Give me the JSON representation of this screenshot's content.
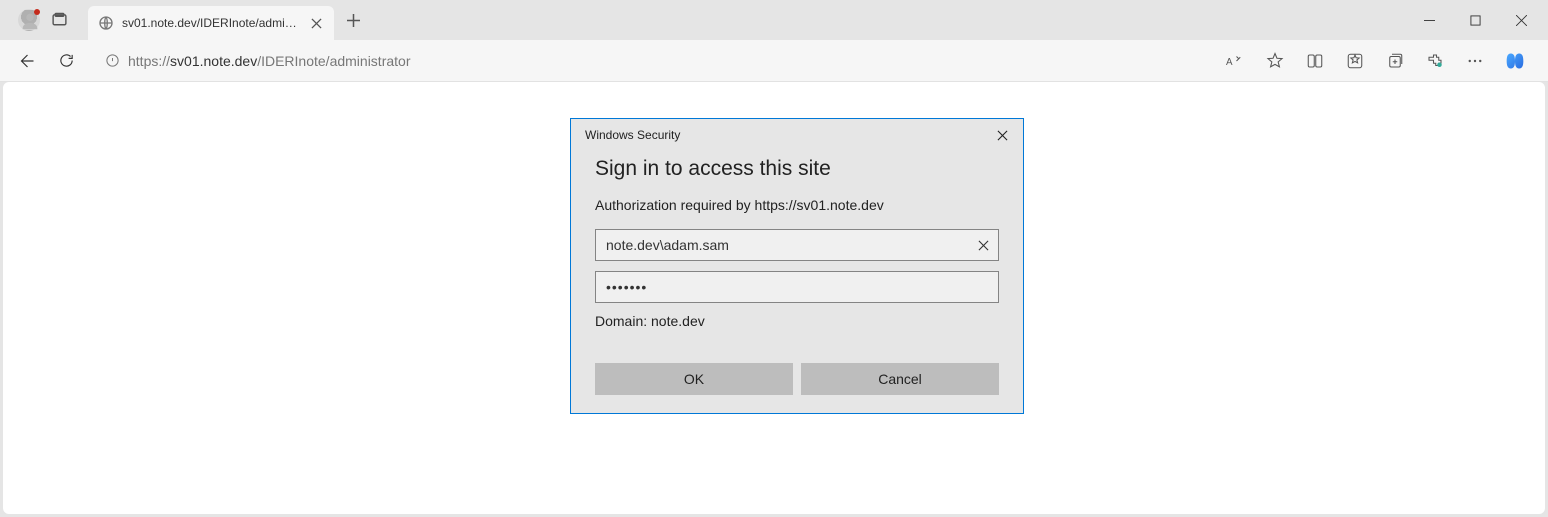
{
  "tab": {
    "title": "sv01.note.dev/IDERInote/administ"
  },
  "url": {
    "scheme": "https://",
    "host": "sv01.note.dev",
    "path": "/IDERInote/administrator"
  },
  "dialog": {
    "title": "Windows Security",
    "heading": "Sign in to access this site",
    "subtitle": "Authorization required by https://sv01.note.dev",
    "username": "note.dev\\adam.sam",
    "password": "•••••••",
    "domain_label": "Domain: note.dev",
    "ok": "OK",
    "cancel": "Cancel"
  }
}
